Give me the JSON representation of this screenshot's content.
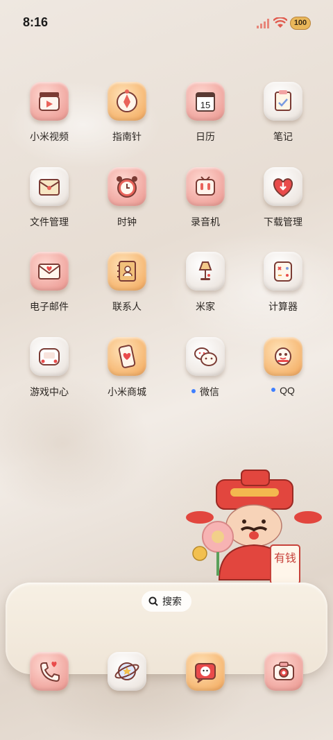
{
  "status_bar": {
    "time": "8:16",
    "battery_level": "100",
    "signal_icon": "cellular-signal-icon",
    "wifi_icon": "wifi-icon"
  },
  "apps": [
    {
      "label": "小米视频",
      "icon": "video-clapper-icon",
      "style": "pink"
    },
    {
      "label": "指南针",
      "icon": "compass-icon",
      "style": "orange"
    },
    {
      "label": "日历",
      "icon": "calendar-icon",
      "style": "pink",
      "date": "15"
    },
    {
      "label": "笔记",
      "icon": "notes-icon",
      "style": "white"
    },
    {
      "label": "文件管理",
      "icon": "folder-icon",
      "style": "white"
    },
    {
      "label": "时钟",
      "icon": "alarm-clock-icon",
      "style": "pink"
    },
    {
      "label": "录音机",
      "icon": "recorder-icon",
      "style": "pink"
    },
    {
      "label": "下载管理",
      "icon": "download-heart-icon",
      "style": "white"
    },
    {
      "label": "电子邮件",
      "icon": "mail-icon",
      "style": "pink"
    },
    {
      "label": "联系人",
      "icon": "contacts-book-icon",
      "style": "orange"
    },
    {
      "label": "米家",
      "icon": "lamp-icon",
      "style": "white"
    },
    {
      "label": "计算器",
      "icon": "calculator-icon",
      "style": "white"
    },
    {
      "label": "游戏中心",
      "icon": "game-controller-icon",
      "style": "white"
    },
    {
      "label": "小米商城",
      "icon": "phone-store-icon",
      "style": "orange"
    },
    {
      "label": "微信",
      "icon": "wechat-icon",
      "style": "white",
      "notification_dot": true
    },
    {
      "label": "QQ",
      "icon": "qq-penguin-icon",
      "style": "orange",
      "notification_dot": true
    }
  ],
  "mascot": {
    "sign_text": "有钱"
  },
  "dock": {
    "search_label": "搜索",
    "apps": [
      {
        "icon": "phone-heart-icon",
        "style": "pink"
      },
      {
        "icon": "browser-planet-icon",
        "style": "white"
      },
      {
        "icon": "messages-cat-icon",
        "style": "orange"
      },
      {
        "icon": "camera-icon",
        "style": "pink"
      }
    ]
  },
  "colors": {
    "accent_blue_dot": "#3e7fff",
    "battery": "#e9b75a"
  }
}
